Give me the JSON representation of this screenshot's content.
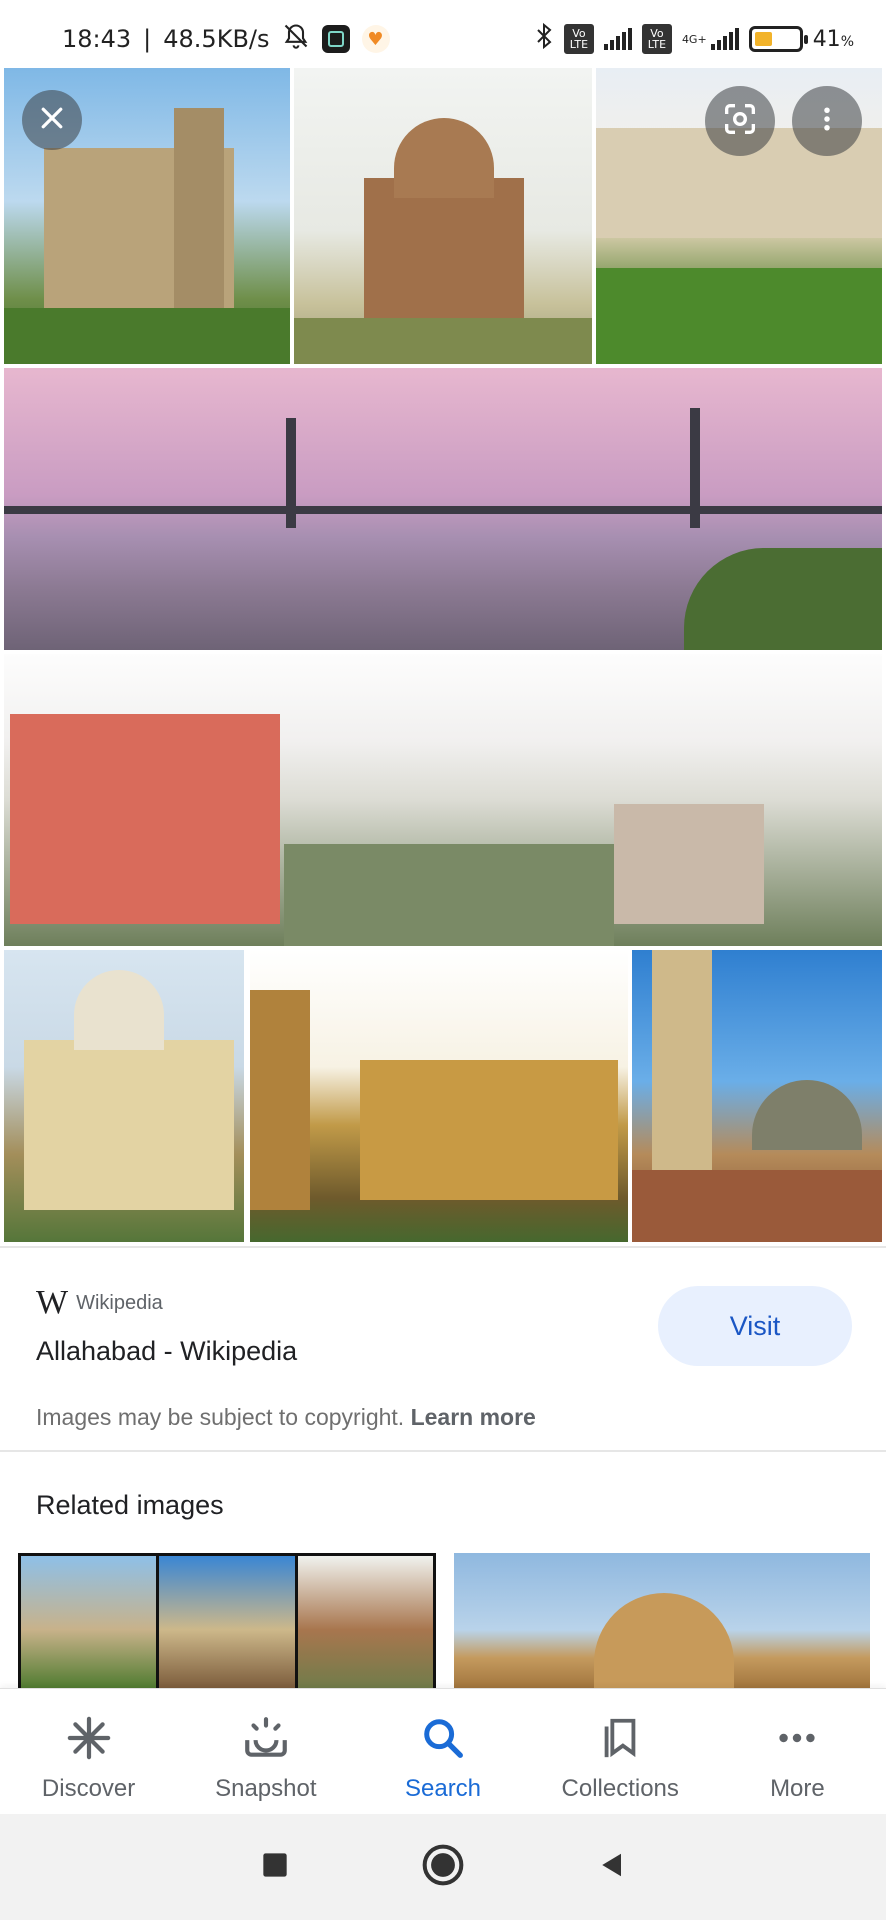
{
  "status_bar": {
    "time": "18:43",
    "separator": "|",
    "speed": "48.5KB/s",
    "battery": "41",
    "battery_fraction": 0.41,
    "volte_label": "Vo LTE",
    "network_label": "4G+"
  },
  "viewer": {
    "close_icon": "close-icon",
    "lens_icon": "lens-icon",
    "more_icon": "more-vert-icon"
  },
  "source": {
    "site_logo": "W",
    "site_name": "Wikipedia",
    "title": "Allahabad - Wikipedia",
    "visit_label": "Visit",
    "copyright_text": "Images may be subject to copyright.",
    "learn_more": "Learn more"
  },
  "related": {
    "title": "Related images"
  },
  "bottom_nav": {
    "items": [
      {
        "label": "Discover",
        "icon": "asterisk-icon"
      },
      {
        "label": "Snapshot",
        "icon": "snapshot-icon"
      },
      {
        "label": "Search",
        "icon": "search-icon"
      },
      {
        "label": "Collections",
        "icon": "collections-icon"
      },
      {
        "label": "More",
        "icon": "more-horiz-icon"
      }
    ],
    "active_color": "#1a6bd6"
  }
}
